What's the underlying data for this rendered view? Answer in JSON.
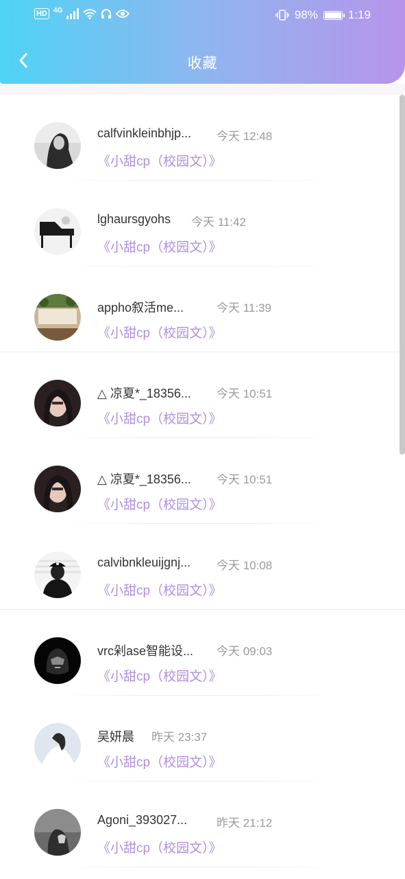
{
  "status_bar": {
    "left_badge": "HD",
    "network": "4G",
    "battery_percent": "98%",
    "time": "1:19"
  },
  "header": {
    "title": "收藏",
    "back_icon": "chevron-left-icon",
    "gradient": [
      "#4fd3f5",
      "#b794ea"
    ]
  },
  "colors": {
    "book_title": "#b08fe0",
    "username": "#333333",
    "time": "#9a9a9a"
  },
  "favorites": [
    {
      "username": "calfvinkleinbhjp...",
      "time": "今天 12:48",
      "book": "《小甜cp（校园文）》",
      "avatar": "avatar-woman-bw"
    },
    {
      "username": "lghaursgyohs",
      "time": "今天 11:42",
      "book": "《小甜cp（校园文）》",
      "avatar": "avatar-piano-sketch"
    },
    {
      "username": "appho叙活me...",
      "time": "今天 11:39",
      "book": "《小甜cp（校园文）》",
      "avatar": "avatar-cafe-sign"
    },
    {
      "username": "△ 凉夏*_18356...",
      "time": "今天 10:51",
      "book": "《小甜cp（校园文）》",
      "avatar": "avatar-girl-dark-hair"
    },
    {
      "username": "△ 凉夏*_18356...",
      "time": "今天 10:51",
      "book": "《小甜cp（校园文）》",
      "avatar": "avatar-girl-dark-hair"
    },
    {
      "username": "calvibnkleuijgnj...",
      "time": "今天 10:08",
      "book": "《小甜cp（校园文）》",
      "avatar": "avatar-cap-person"
    },
    {
      "username": "vrc剁ase智能设...",
      "time": "今天 09:03",
      "book": "《小甜cp（校园文）》",
      "avatar": "avatar-helmet-dark"
    },
    {
      "username": "吴妍晨",
      "time": "昨天 23:37",
      "book": "《小甜cp（校园文）》",
      "avatar": "avatar-girl-white-dress"
    },
    {
      "username": "Agoni_393027...",
      "time": "昨天 21:12",
      "book": "《小甜cp（校园文）》",
      "avatar": "avatar-hand-dark"
    }
  ]
}
